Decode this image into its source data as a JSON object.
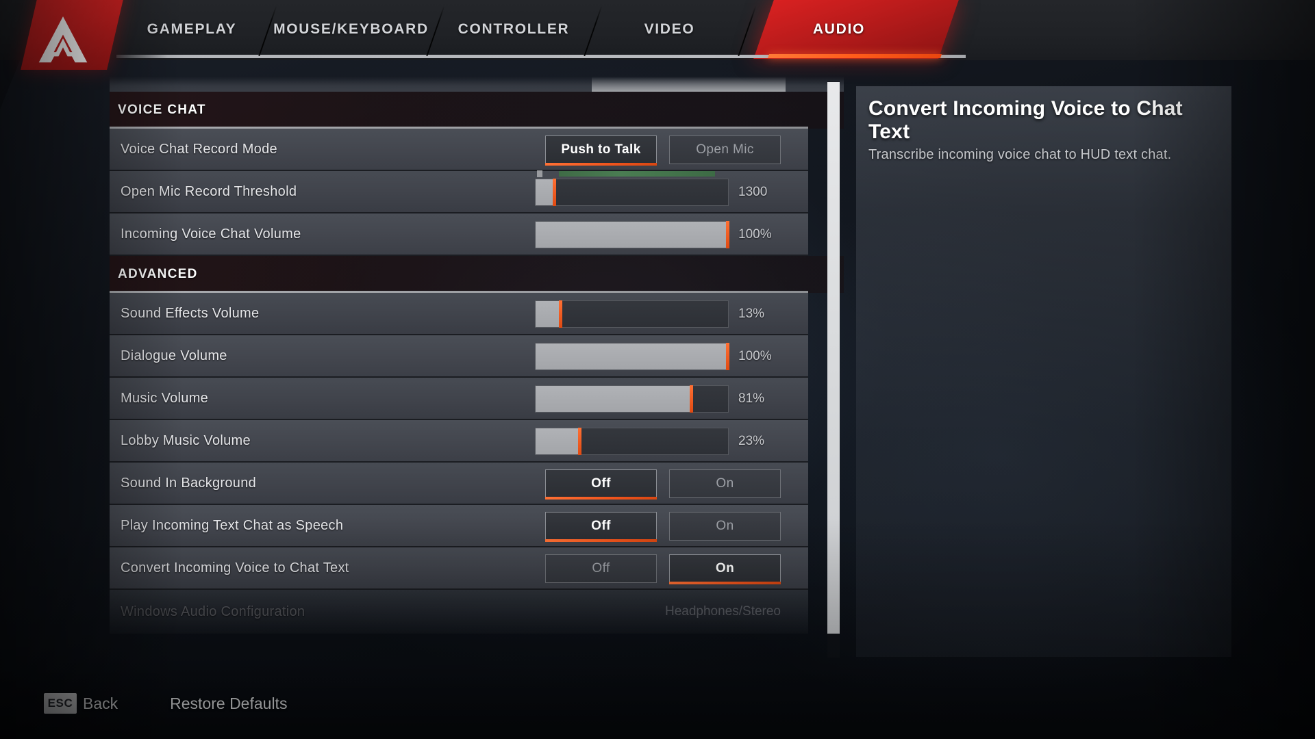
{
  "app": {
    "title": "Apex Legends Settings",
    "logo_icon": "apex-logo-icon"
  },
  "nav": {
    "tabs": [
      {
        "label": "GAMEPLAY",
        "active": false
      },
      {
        "label": "MOUSE/KEYBOARD",
        "active": false
      },
      {
        "label": "CONTROLLER",
        "active": false
      },
      {
        "label": "VIDEO",
        "active": false
      },
      {
        "label": "AUDIO",
        "active": true
      }
    ]
  },
  "sections": [
    {
      "heading": "VOICE CHAT",
      "rows": [
        {
          "label": "Voice Chat Record Mode",
          "type": "segmented",
          "options": [
            {
              "label": "Push to Talk",
              "selected": true
            },
            {
              "label": "Open Mic",
              "selected": false
            }
          ]
        },
        {
          "label": "Open Mic Record Threshold",
          "type": "slider",
          "value_text": "1300",
          "fill_percent": 10,
          "has_meter": true
        },
        {
          "label": "Incoming Voice Chat Volume",
          "type": "slider",
          "value_text": "100%",
          "fill_percent": 100,
          "has_meter": false
        }
      ]
    },
    {
      "heading": "ADVANCED",
      "rows": [
        {
          "label": "Sound Effects Volume",
          "type": "slider",
          "value_text": "13%",
          "fill_percent": 13,
          "has_meter": false
        },
        {
          "label": "Dialogue Volume",
          "type": "slider",
          "value_text": "100%",
          "fill_percent": 100,
          "has_meter": false
        },
        {
          "label": "Music Volume",
          "type": "slider",
          "value_text": "81%",
          "fill_percent": 81,
          "has_meter": false
        },
        {
          "label": "Lobby Music Volume",
          "type": "slider",
          "value_text": "23%",
          "fill_percent": 23,
          "has_meter": false
        },
        {
          "label": "Sound In Background",
          "type": "segmented",
          "options": [
            {
              "label": "Off",
              "selected": true
            },
            {
              "label": "On",
              "selected": false
            }
          ]
        },
        {
          "label": "Play Incoming Text Chat as Speech",
          "type": "segmented",
          "options": [
            {
              "label": "Off",
              "selected": true
            },
            {
              "label": "On",
              "selected": false
            }
          ]
        },
        {
          "label": "Convert Incoming Voice to Chat Text",
          "type": "segmented",
          "options": [
            {
              "label": "Off",
              "selected": false
            },
            {
              "label": "On",
              "selected": true
            }
          ]
        },
        {
          "label": "Windows Audio Configuration",
          "type": "text",
          "value_text": "Headphones/Stereo",
          "disabled": true
        }
      ]
    }
  ],
  "info": {
    "title": "Convert Incoming Voice to Chat Text",
    "description": "Transcribe incoming voice chat to HUD text chat."
  },
  "footer": {
    "esc_key": "ESC",
    "back_label": "Back",
    "restore_label": "Restore Defaults"
  },
  "colors": {
    "accent_orange": "#ff7034",
    "brand_red": "#d92121",
    "slider_fill": "#a3a5a9",
    "meter_green": "#4a7d52"
  }
}
